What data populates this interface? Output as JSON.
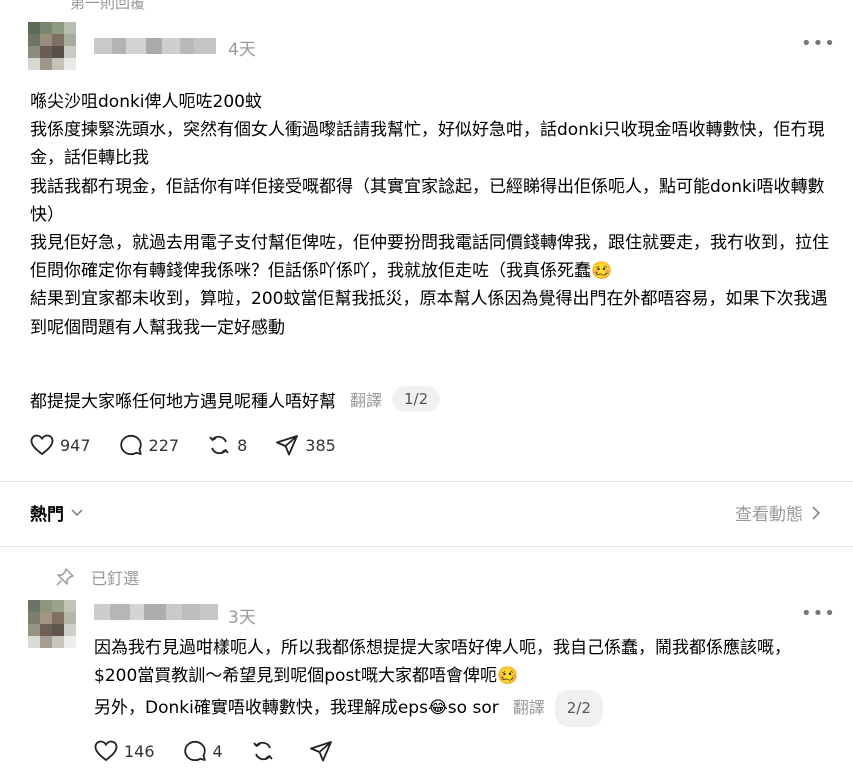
{
  "top_cut_text": "第一則回覆",
  "post": {
    "time": "4天",
    "lines": [
      "喺尖沙咀donki俾人呃咗200蚊",
      "我係度揀緊洗頭水，突然有個女人衝過嚟話請我幫忙，好似好急咁，話donki只收現金唔收轉數快，佢冇現金，話佢轉比我",
      "我話我都冇現金，佢話你有咩佢接受嘅都得（其實宜家諗起，已經睇得出佢係呃人，點可能donki唔收轉數快）",
      "我見佢好急，就過去用電子支付幫佢俾咗，佢仲要扮問我電話同價錢轉俾我，跟住就要走，我冇收到，拉住佢問你確定你有轉錢俾我係咪？佢話係吖係吖，我就放佢走咗（我真係死蠢🥴",
      "結果到宜家都未收到，算啦，200蚊當佢幫我抵災，原本幫人係因為覺得出門在外都唔容易，如果下次我遇到呢個問題有人幫我我一定好感動"
    ],
    "translated_line": "都提提大家喺任何地方遇見呢種人唔好幫",
    "translate_label": "翻譯",
    "pager": "1/2",
    "likes": "947",
    "comments": "227",
    "reposts": "8",
    "shares": "385"
  },
  "feed": {
    "sort_label": "熱門",
    "activity_label": "查看動態"
  },
  "reply": {
    "pinned_label": "已釘選",
    "time": "3天",
    "lines": [
      "因為我冇見過咁樣呃人，所以我都係想提提大家唔好俾人呃，我自己係蠢，鬧我都係應該嘅，$200當買教訓～希望見到呢個post嘅大家都唔會俾呃🥴"
    ],
    "last_line": "另外，Donki確實唔收轉數快，我理解成eps😂so sor",
    "translate_label": "翻譯",
    "pager": "2/2",
    "likes": "146",
    "comments": "4",
    "reposts": "",
    "shares": ""
  },
  "colors": {
    "muted": "#999999",
    "divider": "#e6e6e6",
    "pill": "#f1f1f1"
  },
  "icons": [
    "heart-icon",
    "comment-icon",
    "repost-icon",
    "share-icon",
    "more-icon",
    "pin-icon",
    "chevron-down-icon",
    "chevron-right-icon"
  ]
}
